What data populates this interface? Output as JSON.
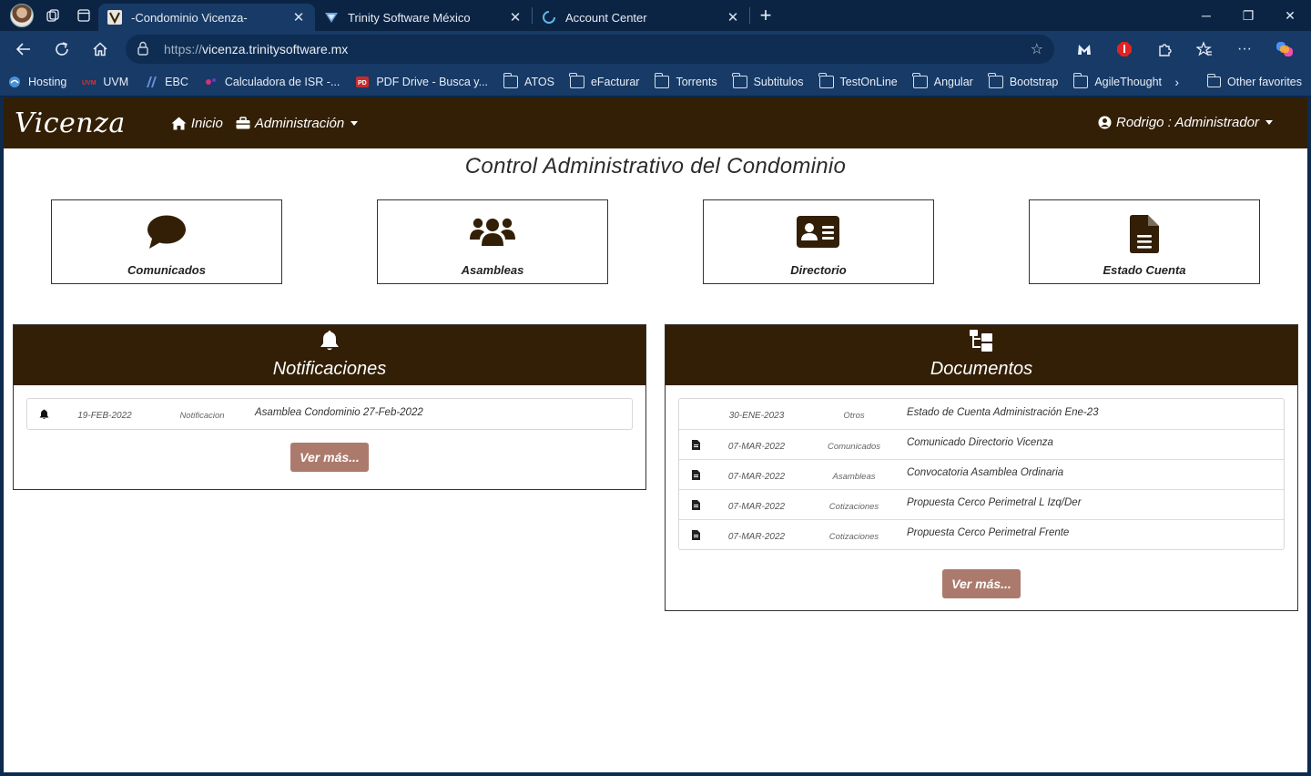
{
  "browser": {
    "tabs": [
      {
        "title": "-Condominio Vicenza-",
        "active": true
      },
      {
        "title": "Trinity Software México",
        "active": false
      },
      {
        "title": "Account Center",
        "active": false
      }
    ],
    "url_protocol": "https://",
    "url_host": "vicenza.trinitysoftware.mx",
    "favorites": [
      {
        "label": "Hosting",
        "icon": "cloud-icon"
      },
      {
        "label": "UVM",
        "icon": "uvm-logo"
      },
      {
        "label": "EBC",
        "icon": "ebc-logo"
      },
      {
        "label": "Calculadora de ISR -...",
        "icon": "calc-logo"
      },
      {
        "label": "PDF Drive - Busca y...",
        "icon": "pdf-logo"
      },
      {
        "label": "ATOS",
        "icon": "folder-icon"
      },
      {
        "label": "eFacturar",
        "icon": "folder-icon"
      },
      {
        "label": "Torrents",
        "icon": "folder-icon"
      },
      {
        "label": "Subtitulos",
        "icon": "folder-icon"
      },
      {
        "label": "TestOnLine",
        "icon": "folder-icon"
      },
      {
        "label": "Angular",
        "icon": "folder-icon"
      },
      {
        "label": "Bootstrap",
        "icon": "folder-icon"
      },
      {
        "label": "AgileThought",
        "icon": "folder-icon"
      }
    ],
    "other_favorites": "Other favorites"
  },
  "app": {
    "brand": "Vicenza",
    "nav_home": "Inicio",
    "nav_admin": "Administración",
    "user": "Rodrigo : Administrador",
    "page_title": "Control Administrativo del Condominio",
    "cards": [
      {
        "label": "Comunicados",
        "icon": "comment-icon"
      },
      {
        "label": "Asambleas",
        "icon": "users-icon"
      },
      {
        "label": "Directorio",
        "icon": "id-card-icon"
      },
      {
        "label": "Estado Cuenta",
        "icon": "file-icon"
      }
    ],
    "notifications": {
      "title": "Notificaciones",
      "rows": [
        {
          "date": "19-FEB-2022",
          "category": "Notificacion",
          "title": "Asamblea Condominio 27-Feb-2022"
        }
      ],
      "more": "Ver más..."
    },
    "documents": {
      "title": "Documentos",
      "rows": [
        {
          "date": "30-ENE-2023",
          "category": "Otros",
          "title": "Estado de Cuenta Administración Ene-23"
        },
        {
          "date": "07-MAR-2022",
          "category": "Comunicados",
          "title": "Comunicado Directorio Vicenza"
        },
        {
          "date": "07-MAR-2022",
          "category": "Asambleas",
          "title": "Convocatoria Asamblea Ordinaria"
        },
        {
          "date": "07-MAR-2022",
          "category": "Cotizaciones",
          "title": "Propuesta Cerco Perimetral L Izq/Der"
        },
        {
          "date": "07-MAR-2022",
          "category": "Cotizaciones",
          "title": "Propuesta Cerco Perimetral Frente"
        }
      ],
      "more": "Ver más..."
    }
  },
  "colors": {
    "nav_bg": "#321f06",
    "button": "#ac7a6d",
    "browser_chrome": "#173a66"
  }
}
